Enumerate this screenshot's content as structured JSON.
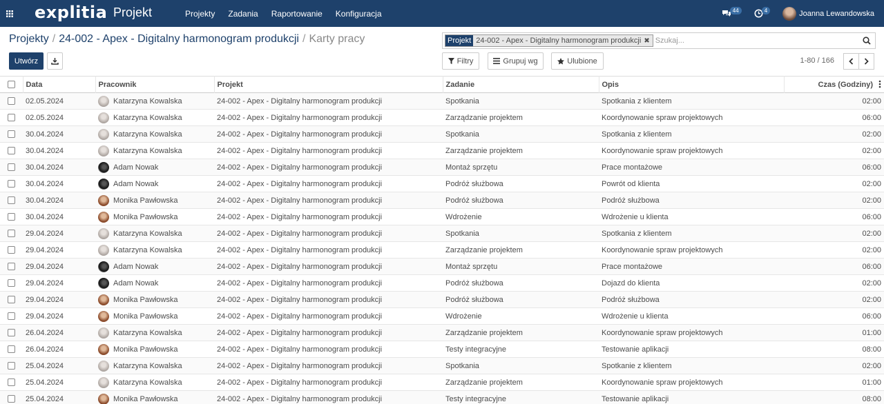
{
  "navbar": {
    "logo": "explitia",
    "app_name": "Projekt",
    "menu": [
      "Projekty",
      "Zadania",
      "Raportowanie",
      "Konfiguracja"
    ],
    "messages_count": "44",
    "activities_count": "4",
    "user_name": "Joanna Lewandowska",
    "bg_color": "#1e416b"
  },
  "breadcrumb": {
    "items": [
      "Projekty",
      "24-002 - Apex - Digitalny harmonogram produkcji"
    ],
    "current": "Karty pracy"
  },
  "toolbar": {
    "create_label": "Utwórz",
    "filters_label": "Filtry",
    "group_by_label": "Grupuj wg",
    "favorites_label": "Ulubione",
    "pager": "1-80 / 166"
  },
  "search": {
    "facet_label": "Projekt",
    "facet_value": "24-002 - Apex - Digitalny harmonogram produkcji",
    "placeholder": "Szukaj..."
  },
  "table": {
    "headers": [
      "Data",
      "Pracownik",
      "Projekt",
      "Zadanie",
      "Opis",
      "Czas (Godziny)"
    ],
    "rows": [
      {
        "date": "02.05.2024",
        "employee": "Katarzyna Kowalska",
        "avatar": "k",
        "project": "24-002 - Apex - Digitalny harmonogram produkcji",
        "task": "Spotkania",
        "desc": "Spotkania z klientem",
        "hours": "02:00"
      },
      {
        "date": "02.05.2024",
        "employee": "Katarzyna Kowalska",
        "avatar": "k",
        "project": "24-002 - Apex - Digitalny harmonogram produkcji",
        "task": "Zarządzanie projektem",
        "desc": "Koordynowanie spraw projektowych",
        "hours": "06:00"
      },
      {
        "date": "30.04.2024",
        "employee": "Katarzyna Kowalska",
        "avatar": "k",
        "project": "24-002 - Apex - Digitalny harmonogram produkcji",
        "task": "Spotkania",
        "desc": "Spotkania z klientem",
        "hours": "02:00"
      },
      {
        "date": "30.04.2024",
        "employee": "Katarzyna Kowalska",
        "avatar": "k",
        "project": "24-002 - Apex - Digitalny harmonogram produkcji",
        "task": "Zarządzanie projektem",
        "desc": "Koordynowanie spraw projektowych",
        "hours": "02:00"
      },
      {
        "date": "30.04.2024",
        "employee": "Adam Nowak",
        "avatar": "a",
        "project": "24-002 - Apex - Digitalny harmonogram produkcji",
        "task": "Montaż sprzętu",
        "desc": "Prace montażowe",
        "hours": "06:00"
      },
      {
        "date": "30.04.2024",
        "employee": "Adam Nowak",
        "avatar": "a",
        "project": "24-002 - Apex - Digitalny harmonogram produkcji",
        "task": "Podróż służbowa",
        "desc": "Powrót od klienta",
        "hours": "02:00"
      },
      {
        "date": "30.04.2024",
        "employee": "Monika Pawłowska",
        "avatar": "m",
        "project": "24-002 - Apex - Digitalny harmonogram produkcji",
        "task": "Podróż służbowa",
        "desc": "Podróż służbowa",
        "hours": "02:00"
      },
      {
        "date": "30.04.2024",
        "employee": "Monika Pawłowska",
        "avatar": "m",
        "project": "24-002 - Apex - Digitalny harmonogram produkcji",
        "task": "Wdrożenie",
        "desc": "Wdrożenie u klienta",
        "hours": "06:00"
      },
      {
        "date": "29.04.2024",
        "employee": "Katarzyna Kowalska",
        "avatar": "k",
        "project": "24-002 - Apex - Digitalny harmonogram produkcji",
        "task": "Spotkania",
        "desc": "Spotkania z klientem",
        "hours": "02:00"
      },
      {
        "date": "29.04.2024",
        "employee": "Katarzyna Kowalska",
        "avatar": "k",
        "project": "24-002 - Apex - Digitalny harmonogram produkcji",
        "task": "Zarządzanie projektem",
        "desc": "Koordynowanie spraw projektowych",
        "hours": "02:00"
      },
      {
        "date": "29.04.2024",
        "employee": "Adam Nowak",
        "avatar": "a",
        "project": "24-002 - Apex - Digitalny harmonogram produkcji",
        "task": "Montaż sprzętu",
        "desc": "Prace montażowe",
        "hours": "06:00"
      },
      {
        "date": "29.04.2024",
        "employee": "Adam Nowak",
        "avatar": "a",
        "project": "24-002 - Apex - Digitalny harmonogram produkcji",
        "task": "Podróż służbowa",
        "desc": "Dojazd do klienta",
        "hours": "02:00"
      },
      {
        "date": "29.04.2024",
        "employee": "Monika Pawłowska",
        "avatar": "m",
        "project": "24-002 - Apex - Digitalny harmonogram produkcji",
        "task": "Podróż służbowa",
        "desc": "Podróż służbowa",
        "hours": "02:00"
      },
      {
        "date": "29.04.2024",
        "employee": "Monika Pawłowska",
        "avatar": "m",
        "project": "24-002 - Apex - Digitalny harmonogram produkcji",
        "task": "Wdrożenie",
        "desc": "Wdrożenie u klienta",
        "hours": "06:00"
      },
      {
        "date": "26.04.2024",
        "employee": "Katarzyna Kowalska",
        "avatar": "k",
        "project": "24-002 - Apex - Digitalny harmonogram produkcji",
        "task": "Zarządzanie projektem",
        "desc": "Koordynowanie spraw projektowych",
        "hours": "01:00"
      },
      {
        "date": "26.04.2024",
        "employee": "Monika Pawłowska",
        "avatar": "m",
        "project": "24-002 - Apex - Digitalny harmonogram produkcji",
        "task": "Testy integracyjne",
        "desc": "Testowanie aplikacji",
        "hours": "08:00"
      },
      {
        "date": "25.04.2024",
        "employee": "Katarzyna Kowalska",
        "avatar": "k",
        "project": "24-002 - Apex - Digitalny harmonogram produkcji",
        "task": "Spotkania",
        "desc": "Spotkanie z klientem",
        "hours": "02:00"
      },
      {
        "date": "25.04.2024",
        "employee": "Katarzyna Kowalska",
        "avatar": "k",
        "project": "24-002 - Apex - Digitalny harmonogram produkcji",
        "task": "Zarządzanie projektem",
        "desc": "Koordynowanie spraw projektowych",
        "hours": "01:00"
      },
      {
        "date": "25.04.2024",
        "employee": "Monika Pawłowska",
        "avatar": "m",
        "project": "24-002 - Apex - Digitalny harmonogram produkcji",
        "task": "Testy integracyjne",
        "desc": "Testowanie aplikacji",
        "hours": "08:00"
      }
    ]
  }
}
